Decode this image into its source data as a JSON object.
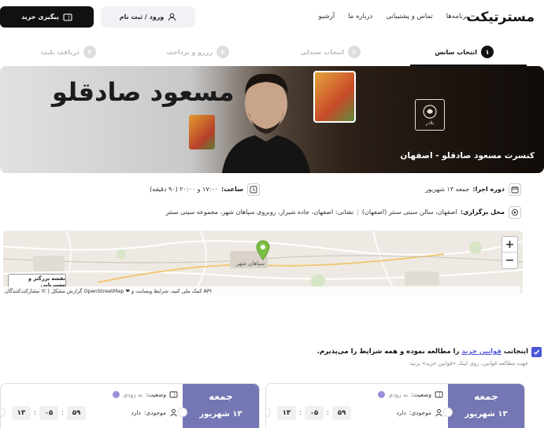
{
  "header": {
    "logo": "مسترتیکت",
    "nav": [
      "برنامه‌ها",
      "تماس و پشتیبانی",
      "درباره ما",
      "آرشیو"
    ],
    "login_label": "ورود / ثبت نام",
    "track_label": "پیگیری خرید"
  },
  "steps": [
    {
      "num": "۱",
      "label": "انتخاب سانس",
      "active": true
    },
    {
      "num": "۲",
      "label": "انتخاب صندلی",
      "active": false
    },
    {
      "num": "۳",
      "label": "رزرو و پرداخت",
      "active": false
    },
    {
      "num": "۴",
      "label": "دریافت بلیت",
      "active": false
    }
  ],
  "banner": {
    "artist_name": "مسعود صادقلو",
    "title": "کنسرت مسعود صادقلو - اصفهان",
    "seal_text": "بلادر"
  },
  "event": {
    "date_label": "دوره اجرا:",
    "date_value": "جمعه ۱۳ شهریور",
    "time_label": "ساعت:",
    "time_value": "۱۷:۰۰ و ۲۰:۰۰ (۹۰ دقیقه)",
    "venue_label": "محل برگزاری:",
    "venue_value": "اصفهان، سالن سیتی سنتر (اصفهان)",
    "address_value": "نشانی: اصفهان، جاده شیراز، روبروی سپاهان شهر، مجموعه سیتی سنتر"
  },
  "map": {
    "zoom_in": "+",
    "zoom_out": "−",
    "bigger_map": "نقشه بزرگتر و مسیریابی",
    "attribution": "API کمک ملی کنید، شرایط وبسایت و ❤ OpenStreetMap گزارش مشکل | © مشارکت‌کنندگان",
    "city_label": "سپاهان شهر"
  },
  "terms": {
    "prefix": "اینجانب ",
    "link": "قوانین خرید",
    "suffix": " را مطالعه نموده و همه شرایط را می‌پذیرم.",
    "note": "جهت مطالعه قوانین، روی لینک «قوانین خرید» بزنید"
  },
  "cards": [
    {
      "day": "جمعه",
      "date": "۱۳ شهریور",
      "status_label": "وضعیت:",
      "status_value": "به زودی",
      "stock_label": "موجودی:",
      "stock_value": "دارد",
      "countdown": [
        "۱۳",
        "۰۵",
        "۵۹"
      ]
    },
    {
      "day": "جمعه",
      "date": "۱۳ شهریور",
      "status_label": "وضعیت:",
      "status_value": "به زودی",
      "stock_label": "موجودی:",
      "stock_value": "دارد",
      "countdown": [
        "۱۳",
        "۰۵",
        "۵۹"
      ]
    }
  ],
  "colors": {
    "primary": "#4a55d8",
    "card_side": "#7477b3",
    "dark": "#111111"
  }
}
